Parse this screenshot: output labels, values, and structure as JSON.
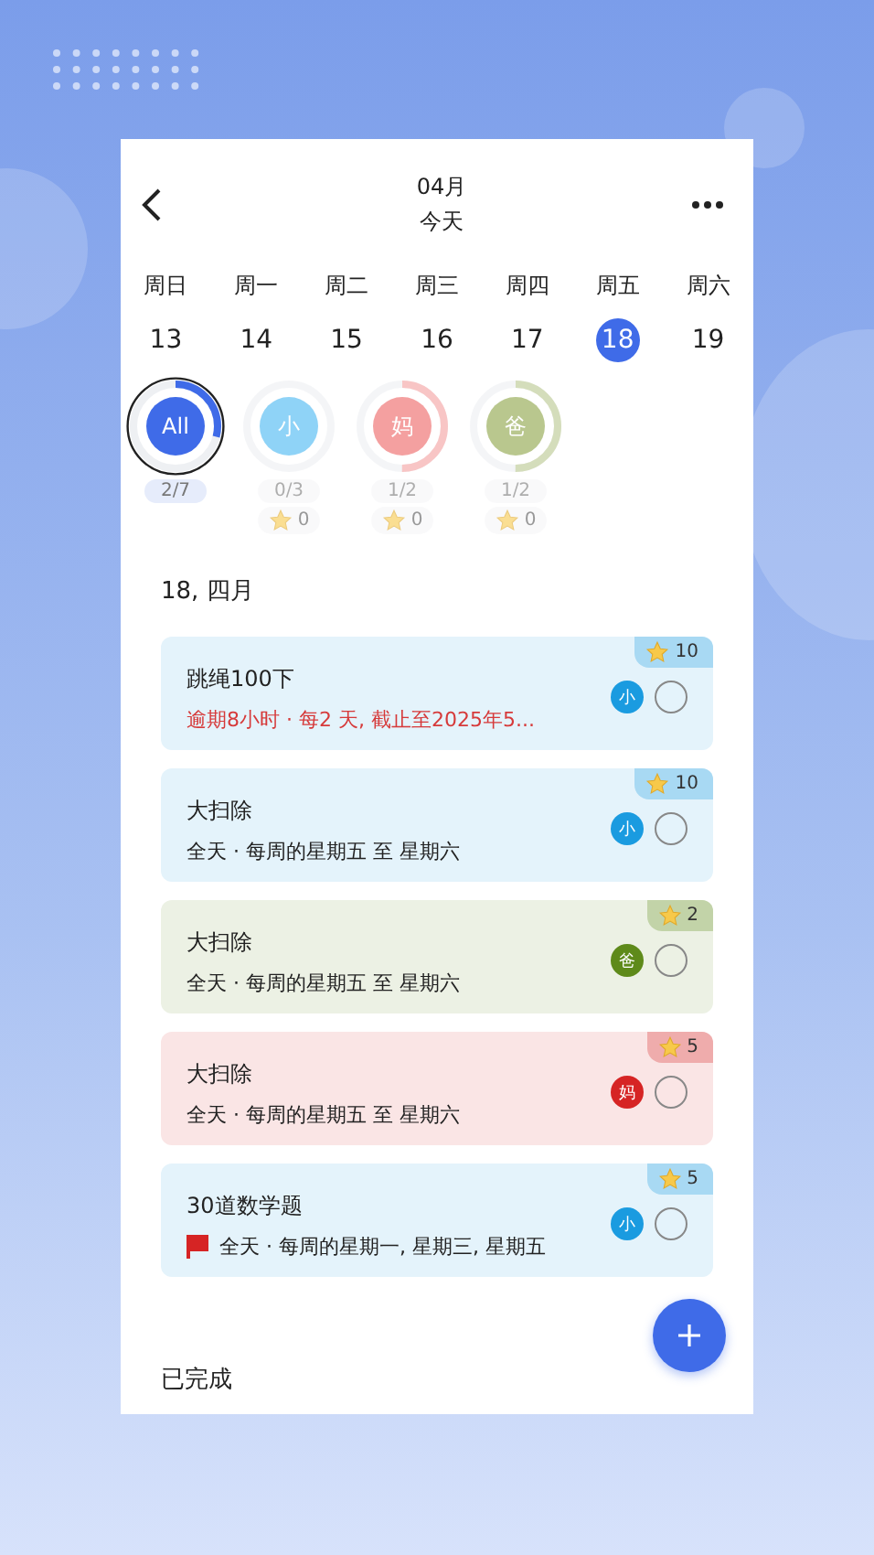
{
  "header": {
    "month": "04月",
    "subtitle": "今天"
  },
  "week": [
    {
      "day": "周日",
      "date": "13",
      "selected": false
    },
    {
      "day": "周一",
      "date": "14",
      "selected": false
    },
    {
      "day": "周二",
      "date": "15",
      "selected": false
    },
    {
      "day": "周三",
      "date": "16",
      "selected": false
    },
    {
      "day": "周四",
      "date": "17",
      "selected": false
    },
    {
      "day": "周五",
      "date": "18",
      "selected": true
    },
    {
      "day": "周六",
      "date": "19",
      "selected": false
    }
  ],
  "members": [
    {
      "label": "All",
      "count": "2/7",
      "selected": true,
      "level": 0.29,
      "color": "#3f6be8"
    },
    {
      "label": "小",
      "count": "0/3",
      "points": "0",
      "selected": false,
      "level": 0,
      "color": "#8fd3f7"
    },
    {
      "label": "妈",
      "count": "1/2",
      "points": "0",
      "selected": false,
      "level": 0.5,
      "color": "#f4a0a0"
    },
    {
      "label": "爸",
      "count": "1/2",
      "points": "0",
      "selected": false,
      "level": 0.5,
      "color": "#b9c78e"
    }
  ],
  "section_title": "18, 四月",
  "tasks": [
    {
      "title": "跳绳100下",
      "detail": "逾期8小时 · 每2 天, 截止至2025年5...",
      "overdue": true,
      "flagged": false,
      "points": "10",
      "assignee": "小",
      "color": "#1a9be0",
      "checked": false
    },
    {
      "title": "大扫除",
      "detail": "全天 · 每周的星期五 至 星期六",
      "overdue": false,
      "flagged": false,
      "points": "10",
      "assignee": "小",
      "color": "#1a9be0",
      "checked": false
    },
    {
      "title": "大扫除",
      "detail": "全天 · 每周的星期五 至 星期六",
      "overdue": false,
      "flagged": false,
      "points": "2",
      "assignee": "爸",
      "color": "#5e8a1a",
      "checked": false
    },
    {
      "title": "大扫除",
      "detail": "全天 · 每周的星期五 至 星期六",
      "overdue": false,
      "flagged": false,
      "points": "5",
      "assignee": "妈",
      "color": "#d62424",
      "checked": false
    },
    {
      "title": "30道数学题",
      "detail": "全天 · 每周的星期一, 星期三, 星期五",
      "overdue": false,
      "flagged": true,
      "points": "5",
      "assignee": "小",
      "color": "#1a9be0",
      "checked": false
    }
  ],
  "completed_title": "已完成"
}
